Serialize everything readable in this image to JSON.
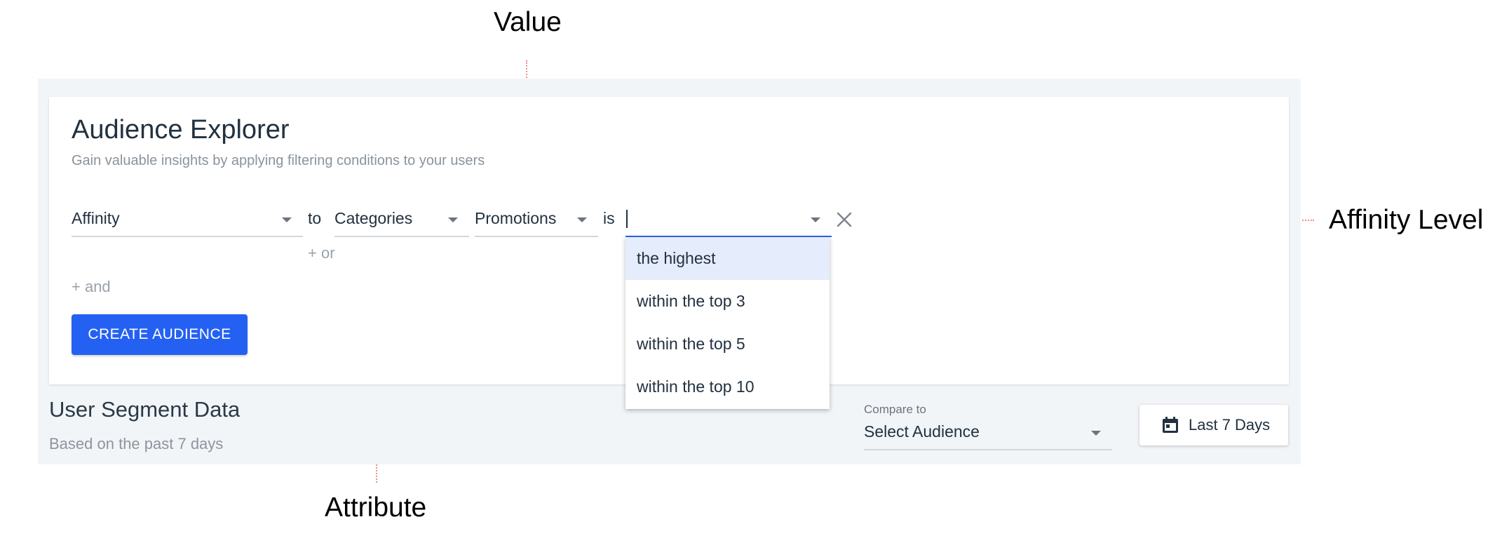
{
  "annotations": {
    "value": "Value",
    "affinity_level": "Affinity Level",
    "attribute": "Attribute"
  },
  "explorer": {
    "title": "Audience Explorer",
    "subtitle": "Gain valuable insights by applying filtering conditions to your users"
  },
  "filter": {
    "type_value": "Affinity",
    "to_label": "to",
    "attribute_value": "Categories",
    "value_value": "Promotions",
    "is_label": "is",
    "level_value": "",
    "or_link": "+ or",
    "and_link": "+ and"
  },
  "dropdown": {
    "options": [
      "the highest",
      "within the top 3",
      "within the top 5",
      "within the top 10"
    ]
  },
  "create_button": "CREATE AUDIENCE",
  "segment": {
    "title": "User Segment Data",
    "subtitle": "Based on the past 7 days"
  },
  "compare": {
    "label": "Compare to",
    "value": "Select Audience"
  },
  "date_range": {
    "label": "Last 7 Days"
  },
  "colors": {
    "primary": "#2461f2",
    "focus": "#2a66e6",
    "annotation_line": "#ef8a8a",
    "highlight": "#e5ecfb"
  }
}
